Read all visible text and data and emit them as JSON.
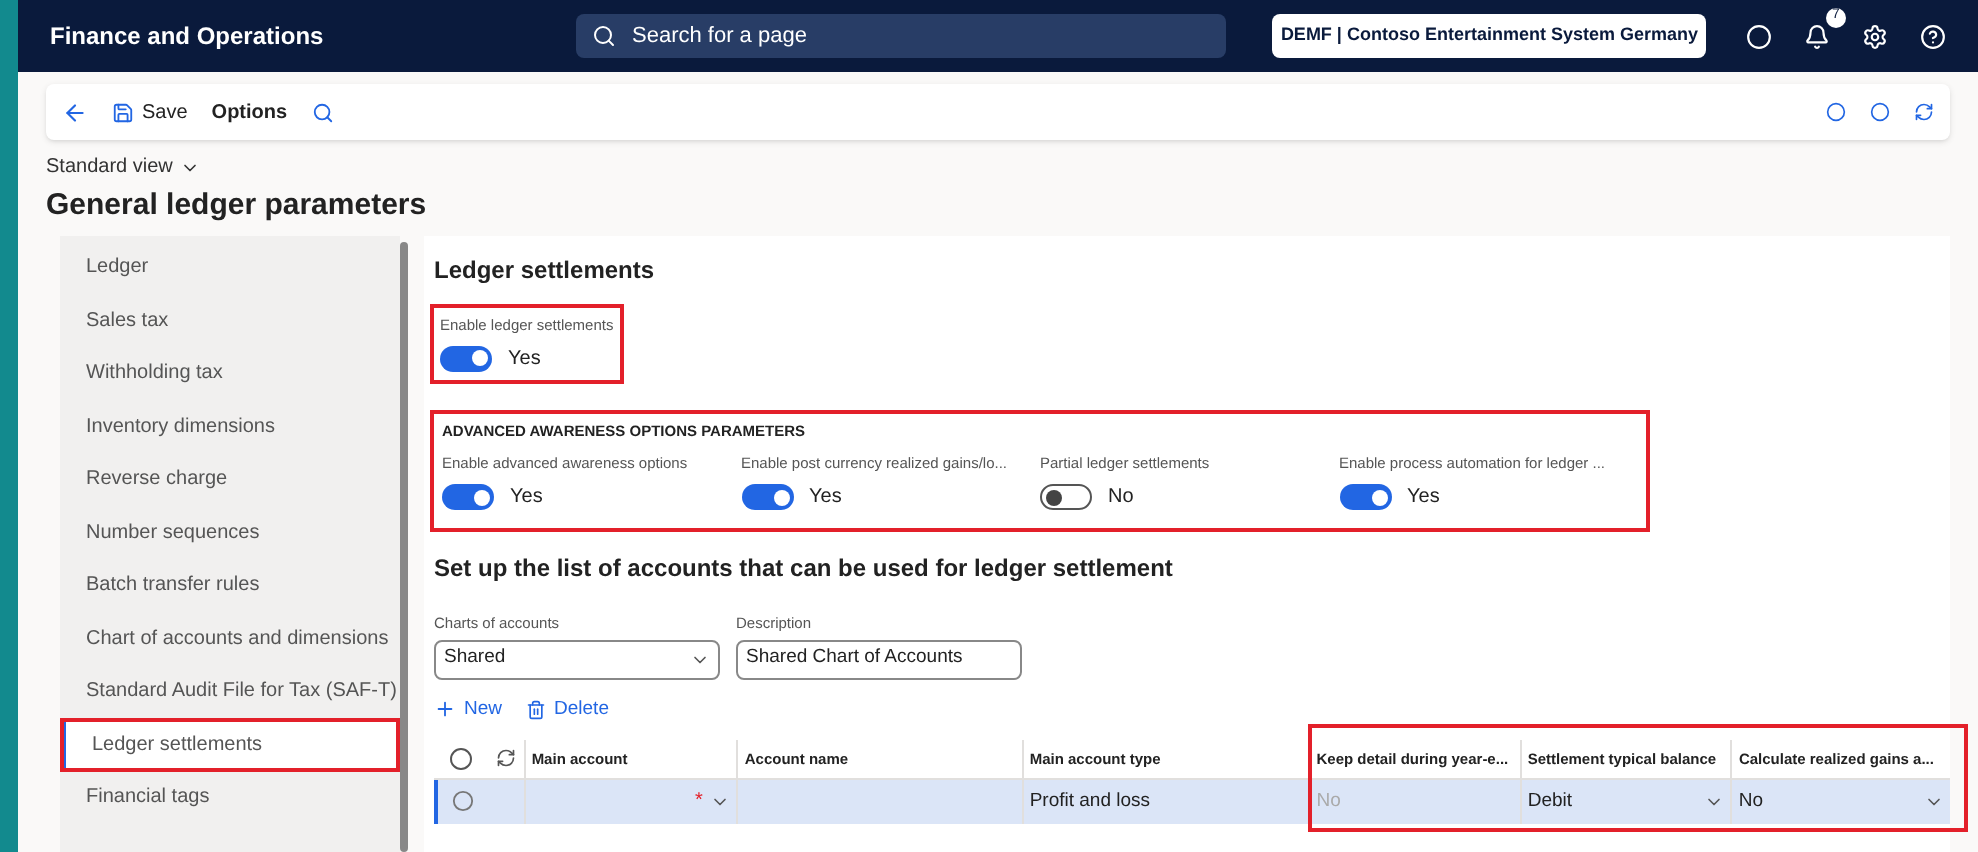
{
  "top_bar": {
    "app_title": "Finance and Operations",
    "search_placeholder": "Search for a page",
    "company": "DEMF | Contoso Entertainment System Germany",
    "notification_count": "7"
  },
  "toolbar": {
    "save": "Save",
    "options": "Options"
  },
  "view_selector": "Standard view",
  "page_title": "General ledger parameters",
  "nav_items": [
    {
      "label": "Ledger",
      "selected": false,
      "highlighted": false
    },
    {
      "label": "Sales tax",
      "selected": false,
      "highlighted": false
    },
    {
      "label": "Withholding tax",
      "selected": false,
      "highlighted": false
    },
    {
      "label": "Inventory dimensions",
      "selected": false,
      "highlighted": false
    },
    {
      "label": "Reverse charge",
      "selected": false,
      "highlighted": false
    },
    {
      "label": "Number sequences",
      "selected": false,
      "highlighted": false
    },
    {
      "label": "Batch transfer rules",
      "selected": false,
      "highlighted": false
    },
    {
      "label": "Chart of accounts and dimensions",
      "selected": false,
      "highlighted": false
    },
    {
      "label": "Standard Audit File for Tax (SAF-T)",
      "selected": false,
      "highlighted": false
    },
    {
      "label": "Ledger settlements",
      "selected": true,
      "highlighted": true
    },
    {
      "label": "Financial tags",
      "selected": false,
      "highlighted": false
    }
  ],
  "section_title": "Ledger settlements",
  "enable_toggle": {
    "label": "Enable ledger settlements",
    "on": true,
    "value": "Yes",
    "highlighted": true
  },
  "advanced": {
    "heading": "ADVANCED AWARENESS OPTIONS PARAMETERS",
    "highlighted": true,
    "toggles": [
      {
        "label": "Enable advanced awareness options",
        "on": true,
        "value": "Yes"
      },
      {
        "label": "Enable post currency realized gains/lo...",
        "on": true,
        "value": "Yes"
      },
      {
        "label": "Partial ledger settlements",
        "on": false,
        "value": "No"
      },
      {
        "label": "Enable process automation for ledger ...",
        "on": true,
        "value": "Yes"
      }
    ]
  },
  "accounts": {
    "heading": "Set up the list of accounts that can be used for ledger settlement",
    "chart_field": {
      "label": "Charts of accounts",
      "value": "Shared"
    },
    "description_field": {
      "label": "Description",
      "value": "Shared Chart of Accounts"
    },
    "actions": [
      "New",
      "Delete"
    ],
    "select_all": {
      "checked": false
    },
    "columns": [
      {
        "label": "Main account",
        "highlighted": false
      },
      {
        "label": "Account name",
        "highlighted": false
      },
      {
        "label": "Main account type",
        "highlighted": false
      },
      {
        "label": "Keep detail during year-e...",
        "highlighted": true
      },
      {
        "label": "Settlement typical balance",
        "highlighted": true
      },
      {
        "label": "Calculate realized gains a...",
        "highlighted": true
      }
    ],
    "rows": [
      {
        "selected": true,
        "cells": [
          {
            "kind": "required",
            "mark": "*"
          },
          {
            "kind": "text"
          },
          {
            "kind": "text",
            "value": "Profit and loss"
          },
          {
            "kind": "disabled",
            "value": "No"
          },
          {
            "kind": "dropdown",
            "value": "Debit"
          },
          {
            "kind": "dropdown",
            "value": "No"
          }
        ]
      }
    ]
  }
}
